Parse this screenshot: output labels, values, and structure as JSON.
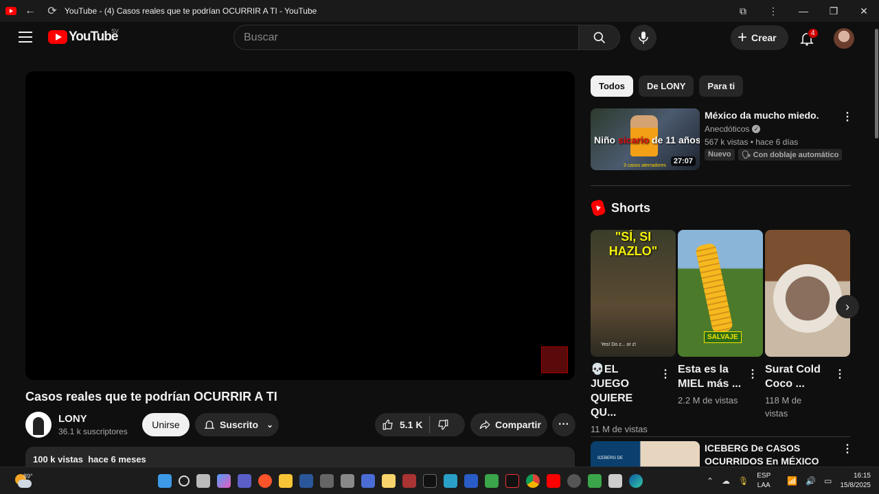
{
  "window": {
    "title": "YouTube - (4) Casos reales que te podrían OCURRIR A TI - YouTube"
  },
  "header": {
    "logo_text": "YouTube",
    "region": "SV",
    "search_placeholder": "Buscar",
    "create_label": "Crear",
    "notification_count": "4"
  },
  "video": {
    "title": "Casos reales que te podrían OCURRIR A TI",
    "channel": "LONY",
    "subscribers": "36.1 k suscriptores",
    "join_label": "Unirse",
    "subscribed_label": "Suscrito",
    "likes": "5.1 K",
    "share_label": "Compartir",
    "description_meta": "100 k vistas  hace 6 meses"
  },
  "chips": [
    "Todos",
    "De LONY",
    "Para ti"
  ],
  "recommendation": {
    "thumb_text_a": "Niño ",
    "thumb_text_b": "sicario",
    "thumb_text_c": " de 11 años",
    "thumb_sub": "3 casos aterradores",
    "duration": "27:07",
    "title": "México da mucho miedo.",
    "channel": "Anecdóticos",
    "meta": "567 k vistas • hace 6 días",
    "badge_new": "Nuevo",
    "badge_dub": "Con doblaje automático"
  },
  "shorts": {
    "heading": "Shorts",
    "items": [
      {
        "overlay": "\"SÍ, SI HAZLO\"",
        "caption": "Yes! Do z... or z!",
        "title": "💀EL JUEGO QUIERE QU...",
        "views": "11 M de vistas"
      },
      {
        "overlay": "SALVAJE",
        "title": "Esta es la MIEL más ...",
        "views": "2.2 M de vistas"
      },
      {
        "title": "Surat Cold Coco ...",
        "views": "118 M de vistas"
      }
    ]
  },
  "recommendation2": {
    "thumb_text": "ICEBERG DE",
    "title": "ICEBERG De CASOS OCURRIDOS En MÉXICO"
  },
  "taskbar": {
    "temperature": "89°",
    "lang_1": "ESP",
    "lang_2": "LAA",
    "time": "16:15",
    "date": "15/8/2025"
  },
  "colors": {
    "youtube_red": "#ff0000",
    "background": "#0f0f0f",
    "surface": "#272727"
  }
}
